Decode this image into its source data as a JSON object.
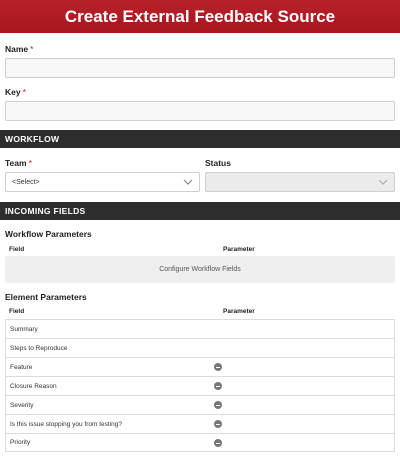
{
  "header": {
    "title": "Create External Feedback Source"
  },
  "form": {
    "name_label": "Name",
    "name_required": "*",
    "key_label": "Key",
    "key_required": "*"
  },
  "workflow": {
    "section_title": "WORKFLOW",
    "team_label": "Team",
    "team_required": "*",
    "team_value": "<Select>",
    "status_label": "Status"
  },
  "incoming": {
    "section_title": "INCOMING FIELDS",
    "workflow_params_title": "Workflow Parameters",
    "field_col": "Field",
    "param_col": "Parameter",
    "configure_text": "Configure Workflow Fields",
    "element_params_title": "Element Parameters",
    "el_field_col": "Field",
    "el_param_col": "Parameter",
    "rows": [
      {
        "field": "Summary",
        "removable": false
      },
      {
        "field": "Steps to Reproduce",
        "removable": false
      },
      {
        "field": "Feature",
        "removable": true
      },
      {
        "field": "Closure Reason",
        "removable": true
      },
      {
        "field": "Severity",
        "removable": true
      },
      {
        "field": "Is this issue stopping you from testing?",
        "removable": true
      },
      {
        "field": "Priority",
        "removable": true
      }
    ]
  },
  "colors": {
    "header": "#b01c25",
    "section_bar": "#2e2e2e",
    "required": "#c0202a"
  }
}
